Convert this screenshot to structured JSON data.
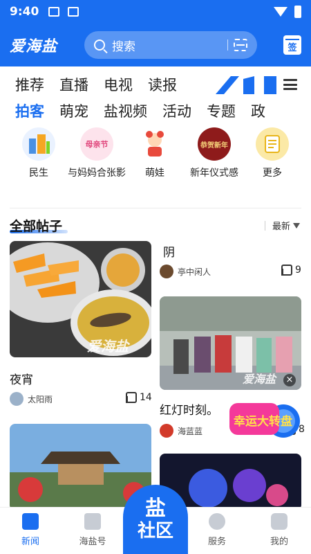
{
  "status_bar": {
    "time": "9:40"
  },
  "header": {
    "logo": "爱海盐",
    "search_placeholder": "搜索",
    "signin_label": "签"
  },
  "tabs_row1": [
    "推荐",
    "直播",
    "电视",
    "读报"
  ],
  "tabs_row2": [
    {
      "label": "拍客",
      "active": true
    },
    {
      "label": "萌宠",
      "active": false
    },
    {
      "label": "盐视频",
      "active": false
    },
    {
      "label": "活动",
      "active": false
    },
    {
      "label": "专题",
      "active": false
    },
    {
      "label": "政",
      "active": false
    }
  ],
  "categories": [
    {
      "label": "民生",
      "icon": "building-icon"
    },
    {
      "label": "与妈妈合张影",
      "icon": "mothers-day-icon",
      "badge": "母亲节"
    },
    {
      "label": "萌娃",
      "icon": "baby-icon"
    },
    {
      "label": "新年仪式感",
      "icon": "new-year-icon",
      "badge": "恭贺新年"
    },
    {
      "label": "更多",
      "icon": "more-icon"
    }
  ],
  "section": {
    "title": "全部帖子",
    "sort_label": "最新"
  },
  "posts": [
    {
      "title": "夜宵",
      "author": "太阳雨",
      "likes": "14",
      "watermark": "爱海盐"
    },
    {
      "title": "阴",
      "author": "亭中闲人",
      "likes": "9"
    },
    {
      "title": "红灯时刻。",
      "author": "海蓝蓝",
      "likes": "8",
      "watermark": "爱海盐"
    },
    {
      "title": "",
      "author": "",
      "likes": ""
    },
    {
      "title": "",
      "author": "",
      "likes": ""
    }
  ],
  "lottery": {
    "text": "幸运大转盘"
  },
  "bottom_nav": [
    {
      "label": "新闻",
      "active": true
    },
    {
      "label": "海盐号",
      "active": false
    },
    {
      "label": "服务",
      "active": false
    },
    {
      "label": "我的",
      "active": false
    }
  ],
  "center_button": {
    "line1": "盐",
    "line2": "社区"
  },
  "colors": {
    "brand": "#1a6ef0"
  }
}
